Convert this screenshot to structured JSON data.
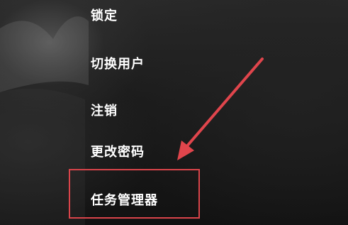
{
  "power_menu": {
    "items": [
      {
        "label": "锁定"
      },
      {
        "label": "切换用户"
      },
      {
        "label": "注销"
      },
      {
        "label": "更改密码"
      },
      {
        "label": "任务管理器"
      }
    ]
  },
  "annotation": {
    "highlight_color": "#d9444a",
    "arrow_color": "#e0454c",
    "highlighted_item": "任务管理器"
  }
}
